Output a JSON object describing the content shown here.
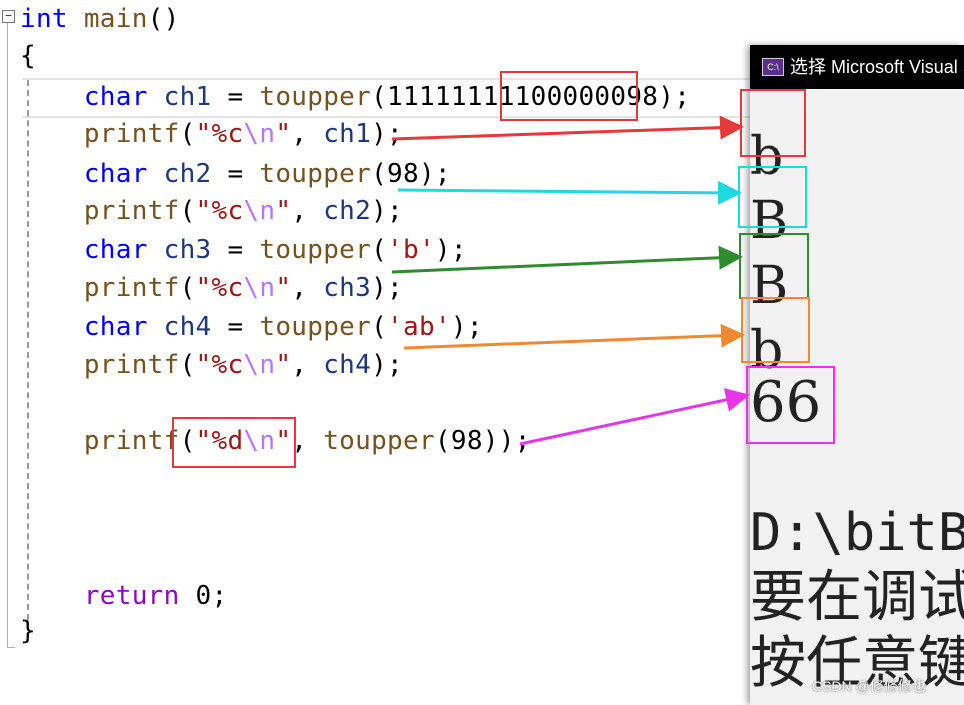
{
  "editor": {
    "lines": [
      [
        {
          "c": "kw",
          "t": "int"
        },
        {
          "c": "p",
          "t": " "
        },
        {
          "c": "fn",
          "t": "main"
        },
        {
          "c": "p",
          "t": "()"
        }
      ],
      [
        {
          "c": "p",
          "t": "{"
        }
      ],
      [
        {
          "c": "p",
          "t": "    "
        },
        {
          "c": "kw",
          "t": "char"
        },
        {
          "c": "p",
          "t": " "
        },
        {
          "c": "var",
          "t": "ch1"
        },
        {
          "c": "p",
          "t": " = "
        },
        {
          "c": "fn",
          "t": "toupper"
        },
        {
          "c": "p",
          "t": "("
        },
        {
          "c": "num",
          "t": "11111111100000098"
        },
        {
          "c": "p",
          "t": ");"
        }
      ],
      [
        {
          "c": "p",
          "t": "    "
        },
        {
          "c": "fn",
          "t": "printf"
        },
        {
          "c": "p",
          "t": "("
        },
        {
          "c": "str",
          "t": "\"%c"
        },
        {
          "c": "esc",
          "t": "\\n"
        },
        {
          "c": "str",
          "t": "\""
        },
        {
          "c": "p",
          "t": ", "
        },
        {
          "c": "var",
          "t": "ch1"
        },
        {
          "c": "p",
          "t": ");"
        }
      ],
      [
        {
          "c": "p",
          "t": "    "
        },
        {
          "c": "kw",
          "t": "char"
        },
        {
          "c": "p",
          "t": " "
        },
        {
          "c": "var",
          "t": "ch2"
        },
        {
          "c": "p",
          "t": " = "
        },
        {
          "c": "fn",
          "t": "toupper"
        },
        {
          "c": "p",
          "t": "("
        },
        {
          "c": "num",
          "t": "98"
        },
        {
          "c": "p",
          "t": ");"
        }
      ],
      [
        {
          "c": "p",
          "t": "    "
        },
        {
          "c": "fn",
          "t": "printf"
        },
        {
          "c": "p",
          "t": "("
        },
        {
          "c": "str",
          "t": "\"%c"
        },
        {
          "c": "esc",
          "t": "\\n"
        },
        {
          "c": "str",
          "t": "\""
        },
        {
          "c": "p",
          "t": ", "
        },
        {
          "c": "var",
          "t": "ch2"
        },
        {
          "c": "p",
          "t": ");"
        }
      ],
      [
        {
          "c": "p",
          "t": "    "
        },
        {
          "c": "kw",
          "t": "char"
        },
        {
          "c": "p",
          "t": " "
        },
        {
          "c": "var",
          "t": "ch3"
        },
        {
          "c": "p",
          "t": " = "
        },
        {
          "c": "fn",
          "t": "toupper"
        },
        {
          "c": "p",
          "t": "("
        },
        {
          "c": "str",
          "t": "'b'"
        },
        {
          "c": "p",
          "t": ");"
        }
      ],
      [
        {
          "c": "p",
          "t": "    "
        },
        {
          "c": "fn",
          "t": "printf"
        },
        {
          "c": "p",
          "t": "("
        },
        {
          "c": "str",
          "t": "\"%c"
        },
        {
          "c": "esc",
          "t": "\\n"
        },
        {
          "c": "str",
          "t": "\""
        },
        {
          "c": "p",
          "t": ", "
        },
        {
          "c": "var",
          "t": "ch3"
        },
        {
          "c": "p",
          "t": ");"
        }
      ],
      [
        {
          "c": "p",
          "t": "    "
        },
        {
          "c": "kw",
          "t": "char"
        },
        {
          "c": "p",
          "t": " "
        },
        {
          "c": "var",
          "t": "ch4"
        },
        {
          "c": "p",
          "t": " = "
        },
        {
          "c": "fn",
          "t": "toupper"
        },
        {
          "c": "p",
          "t": "("
        },
        {
          "c": "str",
          "t": "'ab'"
        },
        {
          "c": "p",
          "t": ");"
        }
      ],
      [
        {
          "c": "p",
          "t": "    "
        },
        {
          "c": "fn",
          "t": "printf"
        },
        {
          "c": "p",
          "t": "("
        },
        {
          "c": "str",
          "t": "\"%c"
        },
        {
          "c": "esc",
          "t": "\\n"
        },
        {
          "c": "str",
          "t": "\""
        },
        {
          "c": "p",
          "t": ", "
        },
        {
          "c": "var",
          "t": "ch4"
        },
        {
          "c": "p",
          "t": ");"
        }
      ],
      [],
      [
        {
          "c": "p",
          "t": "    "
        },
        {
          "c": "fn",
          "t": "printf"
        },
        {
          "c": "p",
          "t": "("
        },
        {
          "c": "str",
          "t": "\"%d"
        },
        {
          "c": "esc",
          "t": "\\n"
        },
        {
          "c": "str",
          "t": "\""
        },
        {
          "c": "p",
          "t": ", "
        },
        {
          "c": "fn",
          "t": "toupper"
        },
        {
          "c": "p",
          "t": "("
        },
        {
          "c": "num",
          "t": "98"
        },
        {
          "c": "p",
          "t": "));"
        }
      ],
      [],
      [],
      [],
      [
        {
          "c": "p",
          "t": "    "
        },
        {
          "c": "ret",
          "t": "return"
        },
        {
          "c": "p",
          "t": " "
        },
        {
          "c": "num",
          "t": "0"
        },
        {
          "c": "p",
          "t": ";"
        }
      ],
      [
        {
          "c": "p",
          "t": "}"
        }
      ]
    ],
    "fold_glyph": "−"
  },
  "console": {
    "title": "选择 Microsoft Visual Studio 调试控制台",
    "icon_text": "C:\\",
    "outputs": [
      "b",
      "B",
      "B",
      "b",
      "66"
    ],
    "tail": [
      "D:\\bitBook\\",
      "要在调试停止时",
      "按任意键关闭此"
    ]
  },
  "annotation_colors": {
    "red": "#e8393a",
    "cyan": "#1ed9e0",
    "green": "#2e8b2e",
    "orange": "#f08a32",
    "magenta": "#e834e8"
  },
  "watermark": "CSDN @修修修也"
}
